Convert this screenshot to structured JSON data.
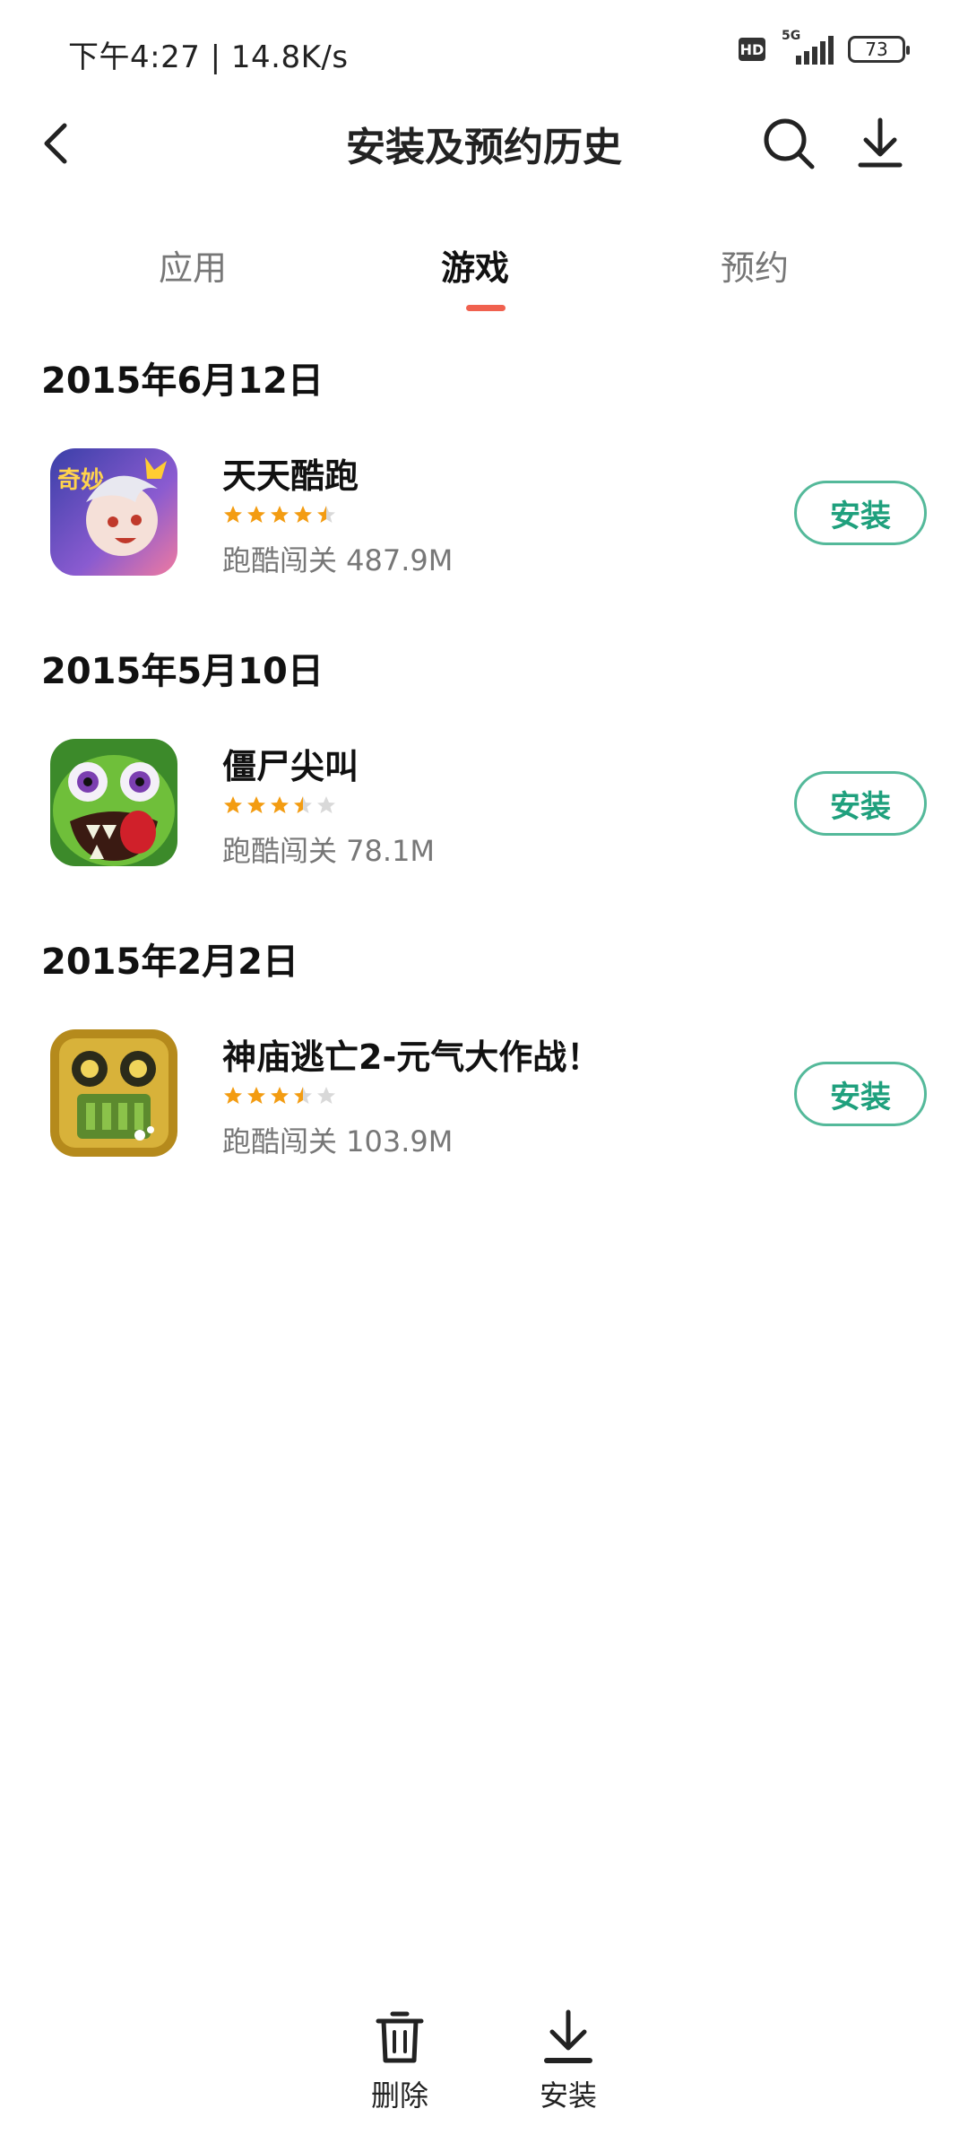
{
  "status_bar": {
    "time": "下午4:27 | 14.8K/s",
    "hd": "HD",
    "network": "5G",
    "battery": "73"
  },
  "header": {
    "title": "安装及预约历史"
  },
  "tabs": [
    {
      "label": "应用",
      "active": false
    },
    {
      "label": "游戏",
      "active": true
    },
    {
      "label": "预约",
      "active": false
    }
  ],
  "sections": [
    {
      "date": "2015年6月12日",
      "app": {
        "name": "天天酷跑",
        "rating": 4.5,
        "meta": "跑酷闯关 487.9M",
        "action": "安装",
        "icon": "tiantian-kupao-app-icon"
      }
    },
    {
      "date": "2015年5月10日",
      "app": {
        "name": "僵尸尖叫",
        "rating": 3.5,
        "meta": "跑酷闯关 78.1M",
        "action": "安装",
        "icon": "zombie-app-icon"
      }
    },
    {
      "date": "2015年2月2日",
      "app": {
        "name": "神庙逃亡2-元气大作战！",
        "rating": 3.5,
        "meta": "跑酷闯关 103.9M",
        "action": "安装",
        "icon": "temple-run-app-icon"
      }
    }
  ],
  "bottom_bar": {
    "delete_label": "删除",
    "install_label": "安装"
  },
  "colors": {
    "accent": "#f0614f",
    "install_green": "#1fa07d",
    "star": "#f39c12"
  }
}
